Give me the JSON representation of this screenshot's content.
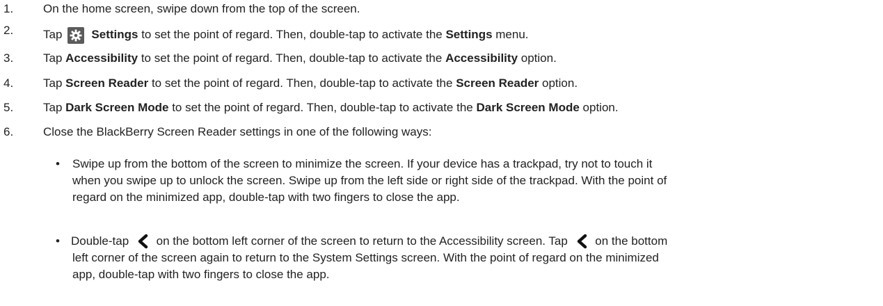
{
  "steps": [
    {
      "num": "1.",
      "parts": [
        "On the home screen, swipe down from the top of the screen."
      ]
    },
    {
      "num": "2.",
      "pre": "Tap ",
      "icon": "gear-icon",
      "b1": "Settings",
      "mid": " to set the point of regard. Then, double-tap to activate the ",
      "b2": "Settings",
      "post": " menu."
    },
    {
      "num": "3.",
      "pre": "Tap ",
      "b1": "Accessibility",
      "mid": " to set the point of regard. Then, double-tap to activate the ",
      "b2": "Accessibility",
      "post": " option."
    },
    {
      "num": "4.",
      "pre": "Tap ",
      "b1": "Screen Reader",
      "mid": " to set the point of regard. Then, double-tap to activate the ",
      "b2": "Screen Reader",
      "post": " option."
    },
    {
      "num": "5.",
      "pre": "Tap ",
      "b1": "Dark Screen Mode",
      "mid": " to set the point of regard. Then, double-tap to activate the ",
      "b2": "Dark Screen Mode",
      "post": " option."
    },
    {
      "num": "6.",
      "parts": [
        "Close the BlackBerry Screen Reader settings in one of the following ways:"
      ]
    }
  ],
  "bullets": [
    {
      "dot": "•",
      "lines": [
        "Swipe up from the bottom of the screen to minimize the screen. If your device has a trackpad, try not to touch it",
        "when you swipe up to unlock the screen. Swipe up from the left side or right side of the trackpad. With the point of",
        "regard on the minimized app, double-tap with two fingers to close the app."
      ]
    },
    {
      "dot": "•",
      "l1a": "Double-tap ",
      "l1b": " on the bottom left corner of the screen to return to the Accessibility screen. Tap ",
      "l1c": " on the bottom",
      "lines": [
        "left corner of the screen again to return to the System Settings screen. With the point of regard on the minimized",
        "app, double-tap with two fingers to close the app."
      ],
      "icon": "back-chevron-icon"
    }
  ]
}
